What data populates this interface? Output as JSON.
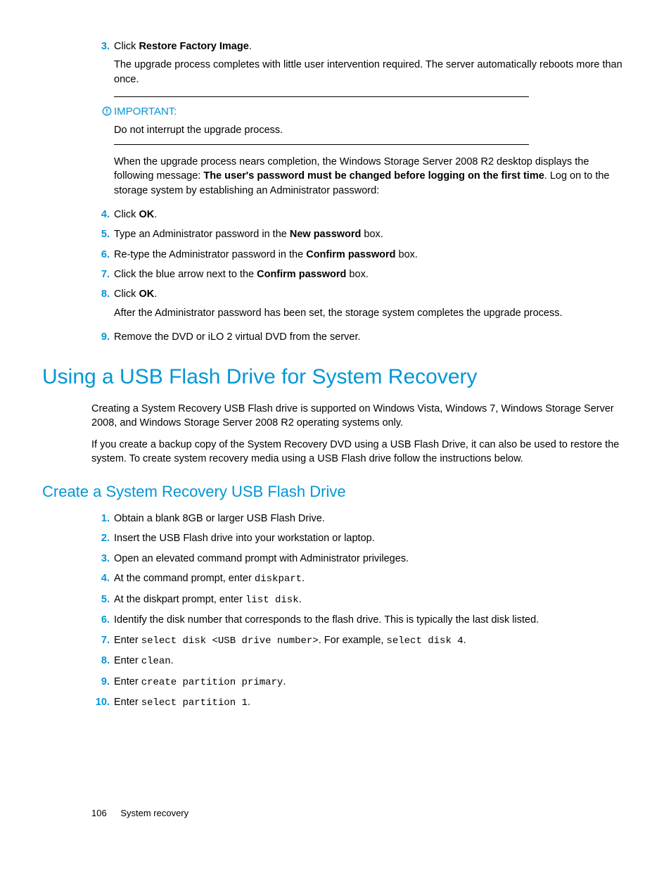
{
  "list1": {
    "items": [
      {
        "num": "3.",
        "runs": [
          {
            "t": "Click "
          },
          {
            "t": "Restore Factory Image",
            "b": true
          },
          {
            "t": "."
          }
        ],
        "sub": [
          {
            "runs": [
              {
                "t": "The upgrade process completes with little user intervention required. The server automatically reboots more than once."
              }
            ]
          }
        ],
        "important": {
          "label": "IMPORTANT:",
          "text": "Do not interrupt the upgrade process."
        },
        "after": [
          {
            "runs": [
              {
                "t": "When the upgrade process nears completion, the Windows Storage Server 2008 R2 desktop displays the following message: "
              },
              {
                "t": "The user's password must be changed before logging on the first time",
                "b": true
              },
              {
                "t": ". Log on to the storage system by establishing an Administrator password:"
              }
            ]
          }
        ]
      },
      {
        "num": "4.",
        "runs": [
          {
            "t": "Click "
          },
          {
            "t": "OK",
            "b": true
          },
          {
            "t": "."
          }
        ]
      },
      {
        "num": "5.",
        "runs": [
          {
            "t": "Type an Administrator password in the "
          },
          {
            "t": "New password",
            "b": true
          },
          {
            "t": " box."
          }
        ]
      },
      {
        "num": "6.",
        "runs": [
          {
            "t": "Re-type the Administrator password in the "
          },
          {
            "t": "Confirm password",
            "b": true
          },
          {
            "t": " box."
          }
        ]
      },
      {
        "num": "7.",
        "runs": [
          {
            "t": "Click the blue arrow next to the "
          },
          {
            "t": "Confirm password",
            "b": true
          },
          {
            "t": " box."
          }
        ]
      },
      {
        "num": "8.",
        "runs": [
          {
            "t": "Click "
          },
          {
            "t": "OK",
            "b": true
          },
          {
            "t": "."
          }
        ],
        "sub": [
          {
            "runs": [
              {
                "t": "After the Administrator password has been set, the storage system completes the upgrade process."
              }
            ]
          }
        ]
      },
      {
        "num": "9.",
        "runs": [
          {
            "t": "Remove the DVD or iLO 2 virtual DVD from the server."
          }
        ]
      }
    ]
  },
  "h1": "Using a USB Flash Drive for System Recovery",
  "paras": [
    "Creating a System Recovery USB Flash drive is supported on Windows Vista, Windows 7, Windows Storage Server 2008, and Windows Storage Server 2008 R2 operating systems only.",
    "If you create a backup copy of the System Recovery DVD using a USB Flash Drive, it can also be used to restore the system. To create system recovery media using a USB Flash drive follow the instructions below."
  ],
  "h2": "Create a System Recovery USB Flash Drive",
  "list2": {
    "items": [
      {
        "num": "1.",
        "runs": [
          {
            "t": "Obtain a blank 8GB or larger USB Flash Drive."
          }
        ]
      },
      {
        "num": "2.",
        "runs": [
          {
            "t": "Insert the USB Flash drive into your workstation or laptop."
          }
        ]
      },
      {
        "num": "3.",
        "runs": [
          {
            "t": "Open an elevated command prompt with Administrator privileges."
          }
        ]
      },
      {
        "num": "4.",
        "runs": [
          {
            "t": "At the command prompt, enter "
          },
          {
            "t": "diskpart",
            "m": true
          },
          {
            "t": "."
          }
        ]
      },
      {
        "num": "5.",
        "runs": [
          {
            "t": "At the diskpart prompt, enter "
          },
          {
            "t": "list disk",
            "m": true
          },
          {
            "t": "."
          }
        ]
      },
      {
        "num": "6.",
        "runs": [
          {
            "t": "Identify the disk number that corresponds to the flash drive. This is typically the last disk listed."
          }
        ]
      },
      {
        "num": "7.",
        "runs": [
          {
            "t": "Enter "
          },
          {
            "t": "select disk <USB drive number>",
            "m": true
          },
          {
            "t": ". For example, "
          },
          {
            "t": "select disk 4",
            "m": true
          },
          {
            "t": "."
          }
        ]
      },
      {
        "num": "8.",
        "runs": [
          {
            "t": "Enter "
          },
          {
            "t": "clean",
            "m": true
          },
          {
            "t": "."
          }
        ]
      },
      {
        "num": "9.",
        "runs": [
          {
            "t": "Enter "
          },
          {
            "t": "create partition primary",
            "m": true
          },
          {
            "t": "."
          }
        ]
      },
      {
        "num": "10.",
        "runs": [
          {
            "t": "Enter "
          },
          {
            "t": "select partition 1",
            "m": true
          },
          {
            "t": "."
          }
        ]
      }
    ]
  },
  "footer": {
    "page": "106",
    "title": "System recovery"
  }
}
